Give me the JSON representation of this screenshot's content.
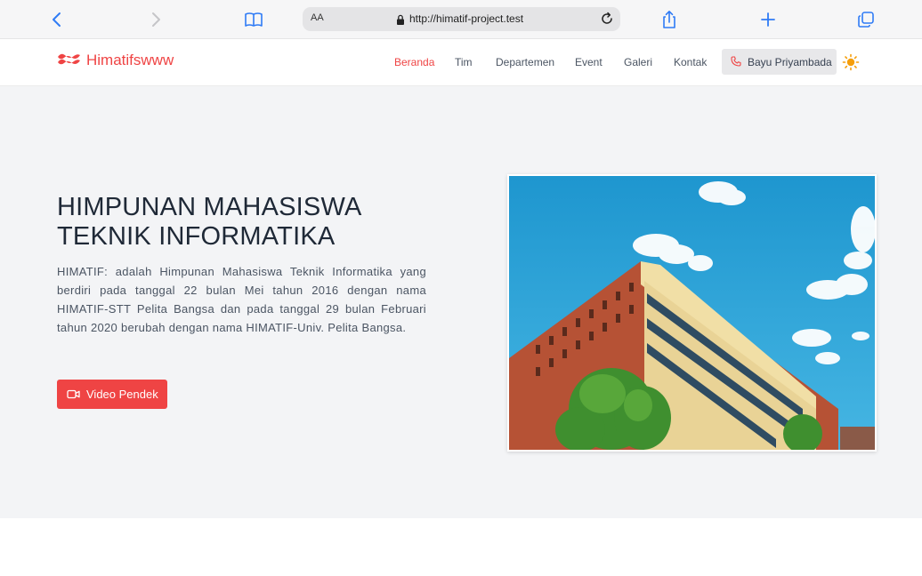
{
  "browser": {
    "text_size_label": "AA",
    "url": "http://himatif-project.test"
  },
  "navbar": {
    "brand": "Himatifswww",
    "links": [
      "Beranda",
      "Tim",
      "Departemen",
      "Event",
      "Galeri",
      "Kontak"
    ],
    "active_link": "Beranda",
    "contact_button": "Bayu Priyambada",
    "theme_icon": "sun-icon"
  },
  "hero": {
    "title_line1": "HIMPUNAN MAHASISWA",
    "title_line2": "TEKNIK INFORMATIKA",
    "description": "HIMATIF: adalah Himpunan Mahasiswa Teknik Informatika yang berdiri pada tanggal 22 bulan Mei tahun 2016 dengan nama HIMATIF-STT Pelita Bangsa dan pada tanggal 29 bulan Februari tahun 2020 berubah dengan nama HIMATIF-Univ. Pelita Bangsa.",
    "video_button": "Video Pendek"
  },
  "colors": {
    "accent": "#ef4444",
    "hero_bg": "#f3f4f6"
  }
}
